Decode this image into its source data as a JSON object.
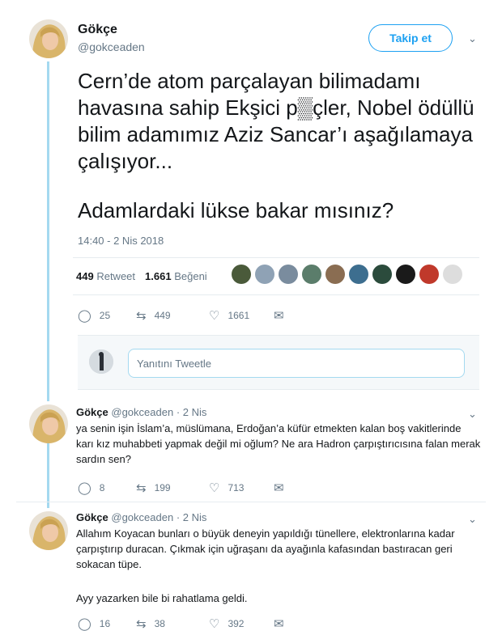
{
  "main": {
    "name": "Gökçe",
    "handle": "@gokceaden",
    "follow_label": "Takip et",
    "text": "Cern’de atom parçalayan bilimadamı havasına sahip Ekşici p▒çler, Nobel ödüllü bilim adamımız Aziz Sancar’ı aşağılamaya çalışıyor...",
    "text2": "Adamlardaki lükse bakar mısınız?",
    "time": "14:40 - 2 Nis 2018",
    "retweet_count": "449",
    "retweet_label": "Retweet",
    "like_count": "1.661",
    "like_label": "Beğeni",
    "actions": {
      "reply": "25",
      "retweet": "449",
      "like": "1661"
    }
  },
  "reply_box": {
    "placeholder": "Yanıtını Tweetle"
  },
  "replies": [
    {
      "name": "Gökçe",
      "handle": "@gokceaden",
      "date": "· 2 Nis",
      "text": "ya senin işin İslam’a, müslümana, Erdoğan’a küfür etmekten kalan boş vakitlerinde karı kız muhabbeti yapmak değil mi oğlum? Ne ara Hadron çarpıştırıcısına falan merak sardın sen?",
      "reply": "8",
      "retweet": "199",
      "like": "713"
    },
    {
      "name": "Gökçe",
      "handle": "@gokceaden",
      "date": "· 2 Nis",
      "text": "Allahım Koyacan bunları o büyük deneyin yapıldığı tünellere, elektronlarına kadar çarpıştırıp duracan. Çıkmak için uğraşanı da ayağınla kafasından bastıracan geri sokacan tüpe.",
      "text2": "Ayy yazarken bile bi rahatlama geldi.",
      "reply": "16",
      "retweet": "38",
      "like": "392"
    }
  ],
  "colors": {
    "accent": "#1da1f2",
    "thread": "#a4d9f0",
    "muted": "#657786"
  }
}
